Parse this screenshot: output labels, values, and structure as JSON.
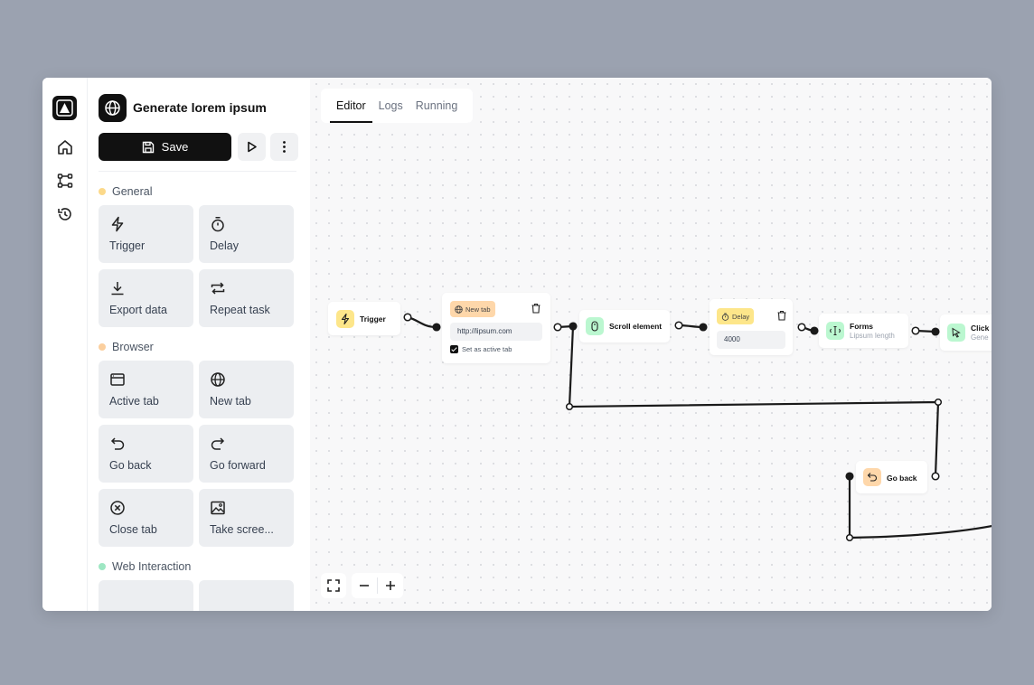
{
  "workflow": {
    "title": "Generate lorem ipsum"
  },
  "toolbar": {
    "save_label": "Save"
  },
  "sidebar": {
    "categories": [
      {
        "label": "General",
        "color": "#fcd98a",
        "blocks": [
          {
            "label": "Trigger",
            "icon": "lightning-icon"
          },
          {
            "label": "Delay",
            "icon": "stopwatch-icon"
          },
          {
            "label": "Export data",
            "icon": "download-icon"
          },
          {
            "label": "Repeat task",
            "icon": "repeat-icon"
          }
        ]
      },
      {
        "label": "Browser",
        "color": "#fbcf9e",
        "blocks": [
          {
            "label": "Active tab",
            "icon": "browser-window-icon"
          },
          {
            "label": "New tab",
            "icon": "globe-icon"
          },
          {
            "label": "Go back",
            "icon": "undo-arrow-icon"
          },
          {
            "label": "Go forward",
            "icon": "redo-arrow-icon"
          },
          {
            "label": "Close tab",
            "icon": "close-circle-icon"
          },
          {
            "label": "Take scree...",
            "icon": "image-icon"
          }
        ]
      },
      {
        "label": "Web Interaction",
        "color": "#9ee7c3"
      }
    ]
  },
  "tabs": [
    {
      "label": "Editor",
      "active": true
    },
    {
      "label": "Logs"
    },
    {
      "label": "Running"
    }
  ],
  "nodes": {
    "trigger": {
      "title": "Trigger",
      "color": "#fde68a"
    },
    "new_tab": {
      "badge": "New tab",
      "badge_color": "#fed7aa",
      "url": "http://lipsum.com",
      "checkbox_label": "Set as active tab",
      "checked": true
    },
    "scroll": {
      "title": "Scroll element",
      "color": "#bbf7d0"
    },
    "delay": {
      "badge": "Delay",
      "badge_color": "#fde68a",
      "value": "4000"
    },
    "forms": {
      "title": "Forms",
      "subtitle": "Lipsum length",
      "color": "#bbf7d0"
    },
    "click": {
      "title": "Click",
      "subtitle": "Gene",
      "color": "#bbf7d0"
    },
    "go_back": {
      "title": "Go back",
      "color": "#fed7aa"
    }
  }
}
